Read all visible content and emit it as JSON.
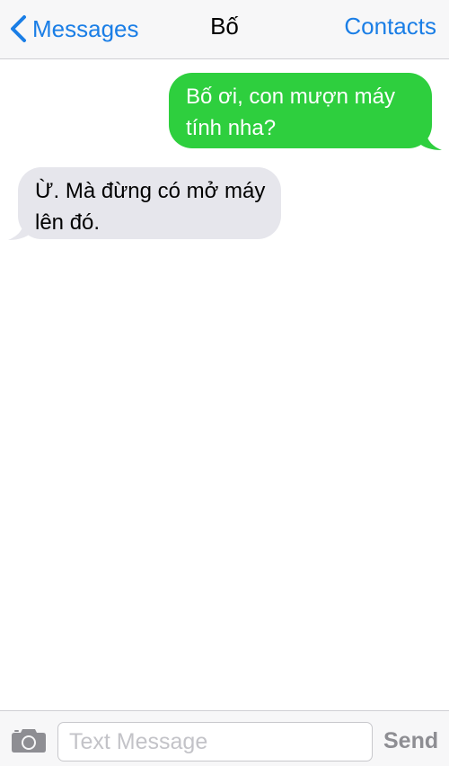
{
  "header": {
    "back_label": "Messages",
    "title": "Bố",
    "contacts_label": "Contacts"
  },
  "messages": [
    {
      "direction": "outgoing",
      "text": "Bố ơi, con mượn máy tính nha?"
    },
    {
      "direction": "incoming",
      "text": "Ừ. Mà đừng có mở máy lên đó."
    }
  ],
  "input_bar": {
    "camera_icon": "camera-icon",
    "placeholder": "Text Message",
    "value": "",
    "send_label": "Send"
  },
  "colors": {
    "accent": "#1a7ee6",
    "outgoing_bubble": "#2ecf3e",
    "incoming_bubble": "#e6e6ec",
    "send_disabled": "#8e8e93"
  }
}
